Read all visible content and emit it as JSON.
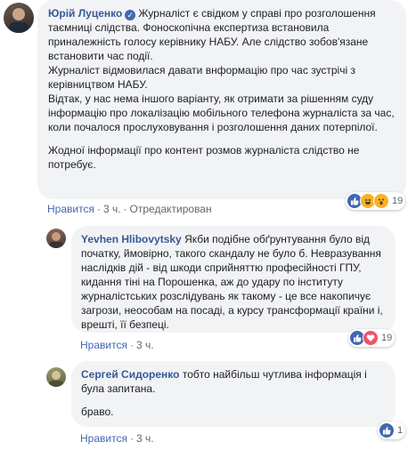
{
  "comment1": {
    "author": "Юрій Луценко",
    "paragraphs": [
      "Журналіст є свідком у справі про розголошення таємниці слідства. Фоноскопічна експертиза встановила приналежність голосу керівнику НАБУ. Але слідство зобов'язане встановити час події.",
      "Журналіст відмовилася давати внформацію про час зустрічі з керівництвом НАБУ.",
      "Відтак, у нас нема іншого варіанту, як отримати за рішенням суду інформацію про локалізацію мобільного телефона журналіста за час, коли почалося прослуховування і розголошення даних потерпілої.",
      "Жодної інформації про контент розмов журналіста слідство не потребує."
    ],
    "like_label": "Нравится",
    "time": "3 ч.",
    "edited_label": "Отредактирован",
    "reaction_count": "19",
    "reactions": [
      "like-icon",
      "haha-icon",
      "wow-icon"
    ]
  },
  "comment2": {
    "author": "Yevhen Hlibovytsky",
    "text": "Якби подібне обґрунтування було від початку, ймовірно, такого скандалу не було б. Невразування наслідків дій - від шкоди сприйняттю професійності ГПУ, кидання тіні на Порошенка, аж до удару по інституту журналістських розслідувань як такому - це все накопичує загрози, неособам на посаді, а курсу трансформації країни і, врешті, її безпеці.",
    "like_label": "Нравится",
    "time": "3 ч.",
    "reaction_count": "19",
    "reactions": [
      "like-icon",
      "love-icon"
    ]
  },
  "comment3": {
    "author": "Сергей Сидоренко",
    "text": "тобто найбільш чутлива інформація і була запитана.",
    "text2": "браво.",
    "like_label": "Нравится",
    "time": "3 ч.",
    "reaction_count": "1",
    "reactions": [
      "like-icon"
    ]
  },
  "colors": {
    "link": "#385898",
    "bubble": "#f2f3f5",
    "like_blue": "#4267b2",
    "love_red": "#f25268",
    "haha_yellow": "#f7b125"
  }
}
